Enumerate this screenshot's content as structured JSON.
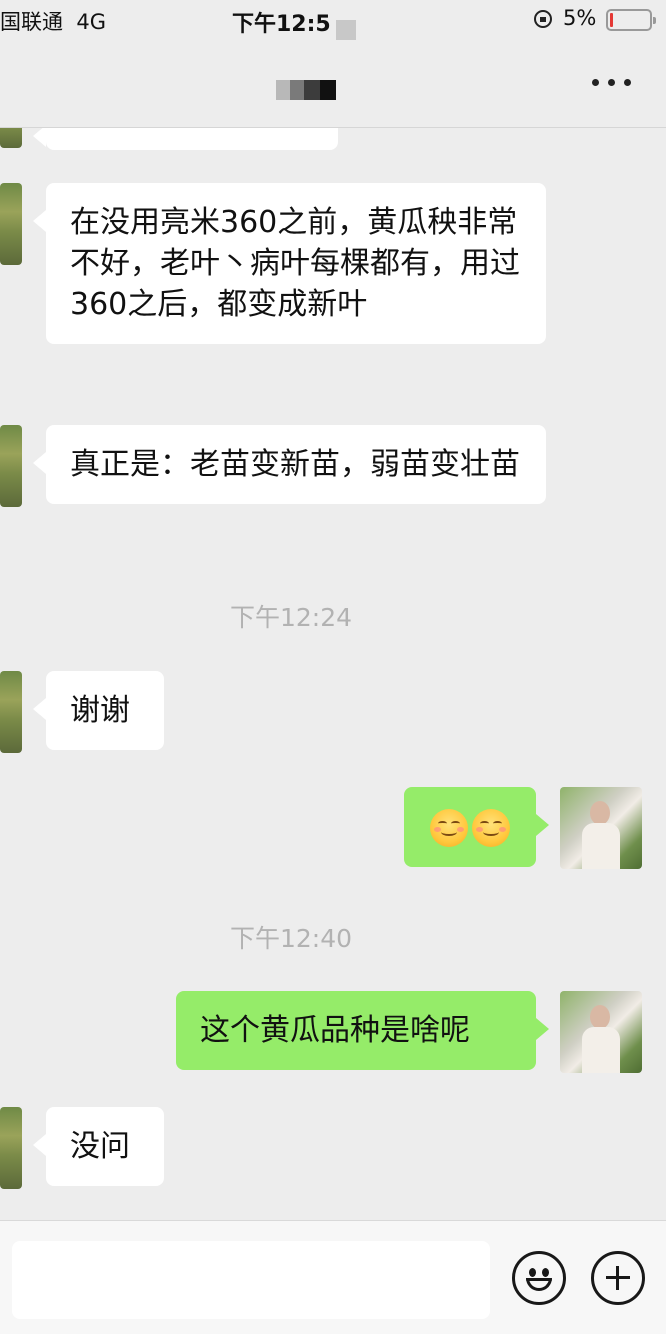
{
  "status_bar": {
    "carrier": "国联通",
    "network": "4G",
    "time": "下午12:5",
    "battery_percent": "5%",
    "battery_level": 0.05
  },
  "nav": {
    "title": "",
    "more_icon": "more-horizontal-icon"
  },
  "messages": [
    {
      "side": "in",
      "text": "在没用亮米360之前，黄瓜秧非常不好，老叶丶病叶每棵都有，用过360之后，都变成新叶"
    },
    {
      "side": "in",
      "text": "真正是：老苗变新苗，弱苗变壮苗"
    },
    {
      "type": "time",
      "text": "下午12:24"
    },
    {
      "side": "in",
      "text": "谢谢"
    },
    {
      "side": "out",
      "emojis": [
        "smiling-face-emoji",
        "smiling-face-emoji"
      ]
    },
    {
      "type": "time",
      "text": "下午12:40"
    },
    {
      "side": "out",
      "text": "这个黄瓜品种是啥呢"
    },
    {
      "side": "in",
      "text": "没问"
    }
  ],
  "input_bar": {
    "placeholder": "",
    "emoji_icon": "emoji-icon",
    "plus_icon": "plus-icon"
  }
}
